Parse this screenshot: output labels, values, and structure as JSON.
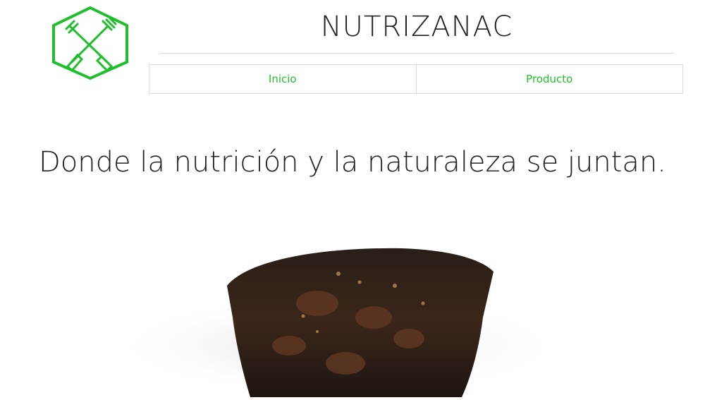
{
  "brand": {
    "name": "NUTRIZANAC",
    "logo_icon": "fork-knife-hexagon-icon",
    "accent": "#1fbf2b"
  },
  "nav": {
    "items": [
      {
        "label": "Inicio"
      },
      {
        "label": "Producto"
      }
    ]
  },
  "hero": {
    "tagline": "Donde la nutrición y la naturaleza se juntan.",
    "image_icon": "product-photo"
  }
}
